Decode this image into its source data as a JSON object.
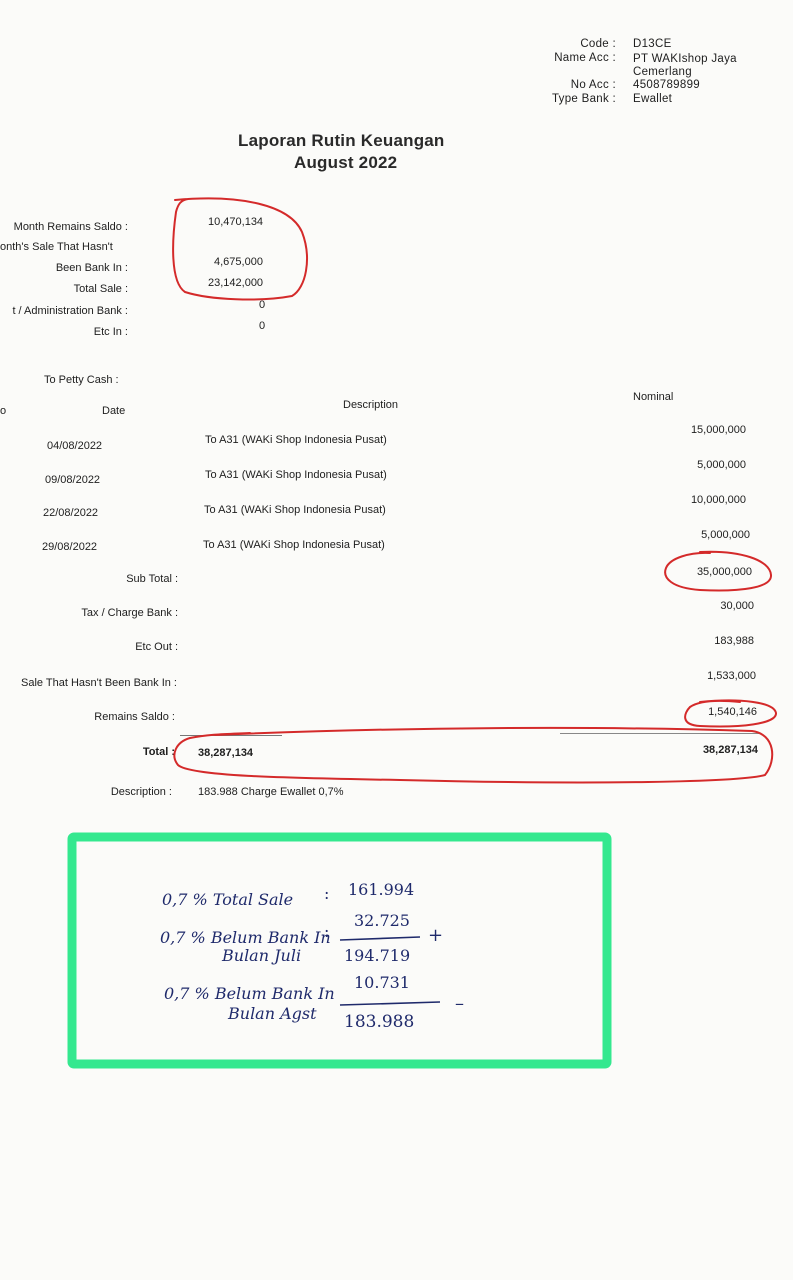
{
  "account": {
    "code_label": "Code :",
    "code": "D13CE",
    "name_label": "Name Acc :",
    "name_line1": "PT WAKIshop Jaya",
    "name_line2": "Cemerlang",
    "no_label": "No Acc :",
    "no": "4508789899",
    "type_label": "Type Bank :",
    "type": "Ewallet"
  },
  "report": {
    "title": "Laporan Rutin Keuangan",
    "period": "August 2022"
  },
  "summary": {
    "remains_label": "Month Remains Saldo :",
    "remains_value": "10,470,134",
    "unbanked_label1": "onth's Sale That Hasn't",
    "unbanked_label2": "Been Bank In :",
    "unbanked_value": "4,675,000",
    "total_sale_label": "Total Sale :",
    "total_sale_value": "23,142,000",
    "admin_label": "t / Administration Bank :",
    "admin_value": "0",
    "etc_in_label": "Etc In :",
    "etc_in_value": "0",
    "petty_label": "To Petty Cash :"
  },
  "table": {
    "col_no": "o",
    "col_date": "Date",
    "col_desc": "Description",
    "col_nominal": "Nominal",
    "rows": [
      {
        "date": "04/08/2022",
        "desc": "To A31 (WAKi Shop Indonesia Pusat)",
        "nominal": "15,000,000"
      },
      {
        "date": "09/08/2022",
        "desc": "To A31 (WAKi Shop Indonesia Pusat)",
        "nominal": "5,000,000"
      },
      {
        "date": "22/08/2022",
        "desc": "To A31 (WAKi Shop Indonesia Pusat)",
        "nominal": "10,000,000"
      },
      {
        "date": "29/08/2022",
        "desc": "To A31 (WAKi Shop Indonesia Pusat)",
        "nominal": "5,000,000"
      }
    ]
  },
  "totals": {
    "subtotal_label": "Sub Total :",
    "subtotal_value": "35,000,000",
    "tax_label": "Tax / Charge Bank :",
    "tax_value": "30,000",
    "etc_out_label": "Etc Out :",
    "etc_out_value": "183,988",
    "unbanked_label": "Sale That Hasn't Been Bank In :",
    "unbanked_value": "1,533,000",
    "remains_label": "Remains Saldo :",
    "remains_value": "1,540,146",
    "total_label": "Total :",
    "total_left": "38,287,134",
    "total_right": "38,287,134",
    "description_label": "Description :",
    "description_value": "183.988 Charge Ewallet 0,7%"
  },
  "handwritten": {
    "line1_label": "0,7 % Total Sale",
    "line1_colon": ":",
    "line1_value": "161.994",
    "line2_label_a": "0,7 % Belum Bank In",
    "line2_label_b": "Bulan Juli",
    "line2_colon": ":",
    "line2_value": "32.725",
    "plus": "+",
    "subtotal": "194.719",
    "line3_label_a": "0,7 % Belum Bank In",
    "line3_label_b": "Bulan Agst",
    "line3_value": "10.731",
    "minus": "–",
    "result": "183.988"
  },
  "colors": {
    "ink_red": "#d42a2a",
    "green_box": "#34e88f",
    "pen_blue": "#1f2a6b"
  }
}
